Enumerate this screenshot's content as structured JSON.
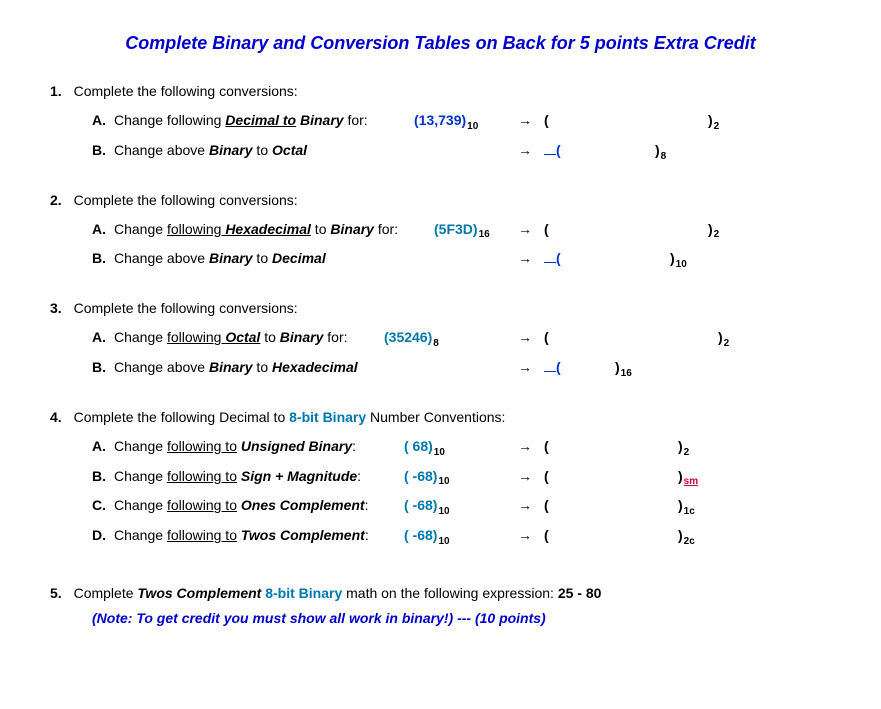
{
  "title": "Complete Binary and Conversion Tables on Back for 5 points Extra Credit",
  "q1": {
    "num": "1.",
    "header": "Complete the following conversions:",
    "a": {
      "label": "A.",
      "pre": "Change following ",
      "emph": "Decimal  to",
      "emph2": " Binary",
      "post": " for:",
      "val": "(13,739)",
      "valsub": "10",
      "arrow": "→",
      "open": "(",
      "close": ")",
      "closesub": "2"
    },
    "b": {
      "label": "B.",
      "pre": "Change above ",
      "emph": "Binary",
      "mid": " to ",
      "emph2": "Octal",
      "arrow": "→",
      "open": "(",
      "close": ")",
      "closesub": "8"
    }
  },
  "q2": {
    "num": "2.",
    "header": "Complete the following conversions:",
    "a": {
      "label": "A.",
      "pre": "Change ",
      "und": "following ",
      "emph": " Hexadecimal",
      "mid": " to ",
      "emph2": "Binary",
      "post": " for:  ",
      "val": "(5F3D)",
      "valsub": "16",
      "arrow": "→",
      "open": "(",
      "close": ")",
      "closesub": "2"
    },
    "b": {
      "label": "B.",
      "pre": "Change above ",
      "emph": "Binary",
      "mid": " to ",
      "emph2": "Decimal",
      "arrow": "→",
      "open": "(",
      "close": ")",
      "closesub": "10"
    }
  },
  "q3": {
    "num": "3.",
    "header": "Complete the following conversions:",
    "a": {
      "label": "A.",
      "pre": "Change ",
      "und": "following ",
      "emph": " Octal",
      "mid": " to ",
      "emph2": "Binary",
      "post": " for:",
      "val": "(35246)",
      "valsub": "8",
      "arrow": "→",
      "open": "(",
      "close": ")",
      "closesub": "2"
    },
    "b": {
      "label": "B.",
      "pre": "Change above ",
      "emph": "Binary",
      "mid": " to ",
      "emph2": "Hexadecimal",
      "arrow": "→",
      "open": "(",
      "close": ")",
      "closesub": "16"
    }
  },
  "q4": {
    "num": "4.",
    "header_pre": "Complete the following Decimal to ",
    "header_em": "8-bit Binary",
    "header_post": " Number Conventions:",
    "a": {
      "label": "A.",
      "pre": "Change ",
      "und": "following  to",
      "emph": " Unsigned Binary",
      "colon": ":",
      "val": "(  68)",
      "valsub": "10",
      "arrow": "→",
      "open": "(",
      "close": ")",
      "closesub": "2"
    },
    "b": {
      "label": "B.",
      "pre": "Change ",
      "und": "following  to",
      "emph": " Sign + Magnitude",
      "colon": ":",
      "val": "( -68)",
      "valsub": "10",
      "arrow": "→",
      "open": "(",
      "close": ")",
      "closesub": "sm"
    },
    "c": {
      "label": "C.",
      "pre": "Change ",
      "und": "following  to",
      "emph": " Ones Complement",
      "colon": ":",
      "val": "( -68)",
      "valsub": "10",
      "arrow": "→",
      "open": "(",
      "close": ")",
      "closesub": "1c"
    },
    "d": {
      "label": "D.",
      "pre": "Change ",
      "und": "following  to",
      "emph": " Twos Complement",
      "colon": ":",
      "val": "( -68)",
      "valsub": "10",
      "arrow": "→",
      "open": "(",
      "close": ")",
      "closesub": "2c"
    }
  },
  "q5": {
    "num": "5.",
    "pre": "Complete ",
    "emph": "Twos Complement",
    "mid": " ",
    "emph2": "8-bit Binary",
    "post": " math on the following expression:    ",
    "expr": "25 - 80",
    "note": "(Note:  To get credit you must show all work in binary!) --- (10 points)"
  }
}
